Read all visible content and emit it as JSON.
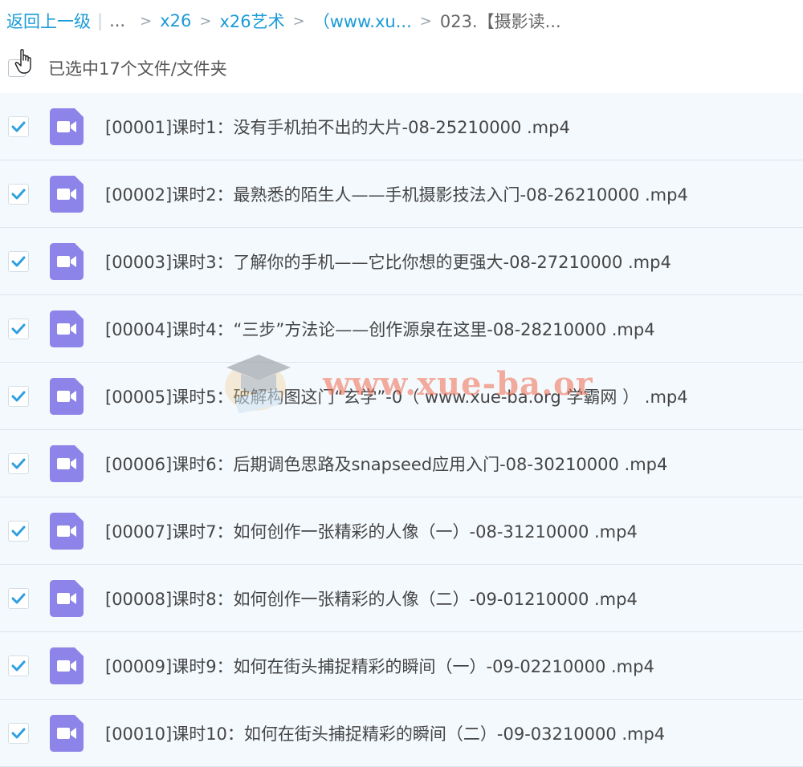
{
  "breadcrumb": {
    "back": "返回上一级",
    "bar": "|",
    "ellipsis": "...",
    "arrow": ">",
    "items": [
      "x26",
      "x26艺术",
      "（www.xu..."
    ],
    "current": "023.【摄影读..."
  },
  "selection": {
    "text": "已选中17个文件/文件夹"
  },
  "files": [
    {
      "name": "[00001]课时1：没有手机拍不出的大片-08-25210000 .mp4"
    },
    {
      "name": "[00002]课时2：最熟悉的陌生人——手机摄影技法入门-08-26210000 .mp4"
    },
    {
      "name": "[00003]课时3：了解你的手机——它比你想的更强大-08-27210000 .mp4"
    },
    {
      "name": "[00004]课时4：“三步”方法论——创作源泉在这里-08-28210000 .mp4"
    },
    {
      "name": "[00005]课时5：破解构图这门“玄学”-0（ www.xue-ba.org 学霸网 ） .mp4"
    },
    {
      "name": "[00006]课时6：后期调色思路及snapseed应用入门-08-30210000 .mp4"
    },
    {
      "name": "[00007]课时7：如何创作一张精彩的人像（一）-08-31210000 .mp4"
    },
    {
      "name": "[00008]课时8：如何创作一张精彩的人像（二）-09-01210000 .mp4"
    },
    {
      "name": "[00009]课时9：如何在街头捕捉精彩的瞬间（一）-09-02210000 .mp4"
    },
    {
      "name": "[00010]课时10：如何在街头捕捉精彩的瞬间（二）-09-03210000 .mp4"
    }
  ],
  "watermark": {
    "text": "www.xue-ba.org"
  },
  "colors": {
    "link": "#1a9bd7",
    "row_bg": "#f4f9fd",
    "check": "#2e9fe0",
    "video_icon": "#8c84e8",
    "watermark": "#f06a4e"
  },
  "icons": {
    "row_check": "checkbox-checked-icon",
    "file_type": "video-file-icon",
    "cursor": "hand-cursor-icon"
  }
}
